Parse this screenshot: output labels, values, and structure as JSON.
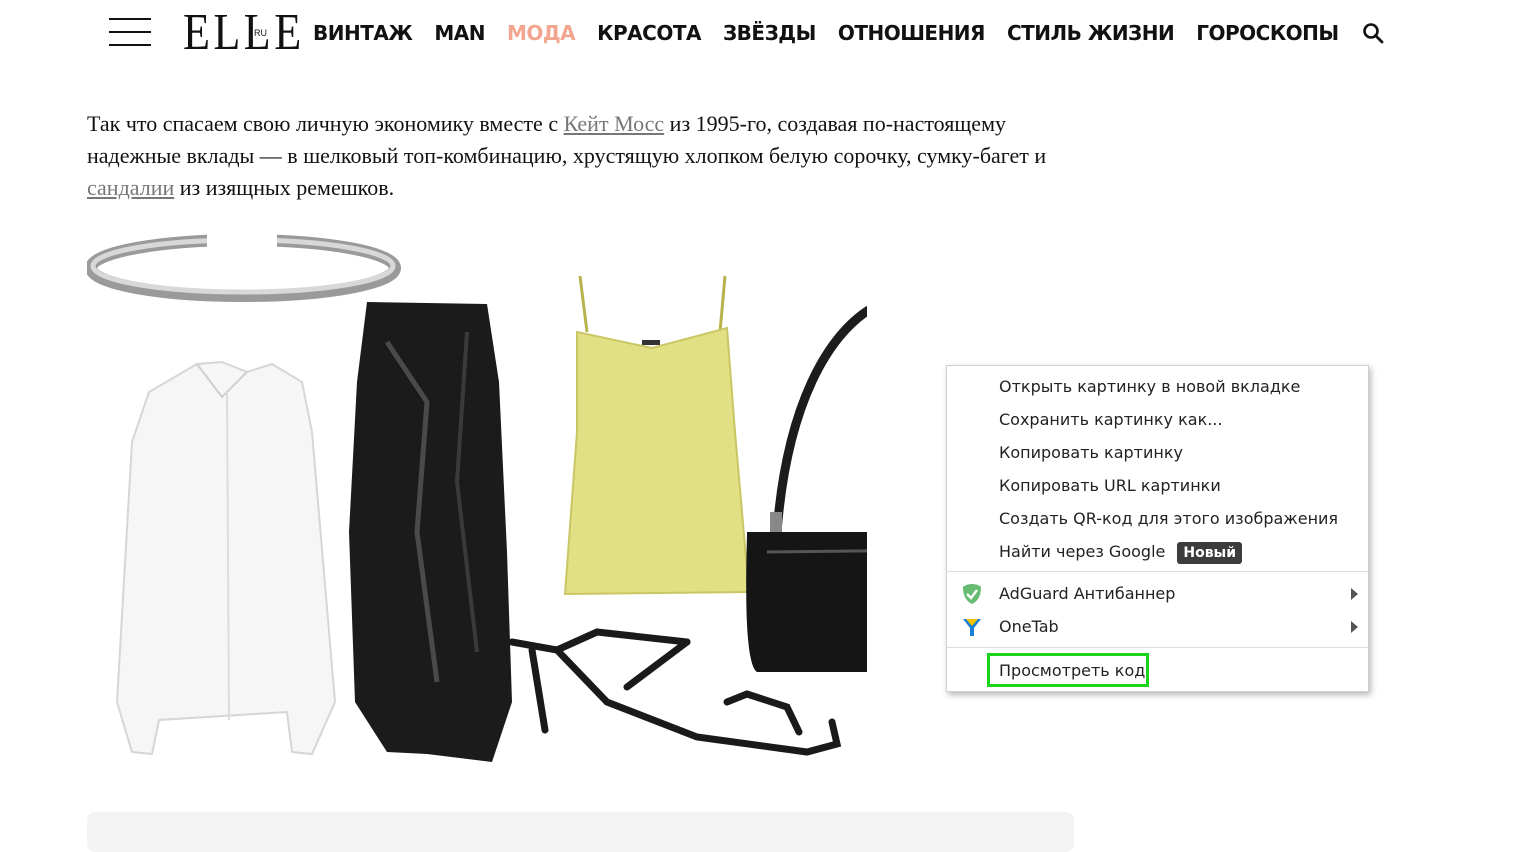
{
  "header": {
    "logo": "ELLE",
    "logo_suffix": "RU",
    "nav": [
      "ВИНТАЖ",
      "MAN",
      "МОДА",
      "КРАСОТА",
      "ЗВЁЗДЫ",
      "ОТНОШЕНИЯ",
      "СТИЛЬ ЖИЗНИ",
      "ГОРОСКОПЫ"
    ],
    "active_nav": "МОДА",
    "active_color": "#f3a68f"
  },
  "article": {
    "text_1": "Так что спасаем свою личную экономику вместе с ",
    "link_1": "Кейт Мосс",
    "text_2": " из 1995-го, создавая по-настоящему надежные вклады — в шелковый топ-комбинацию, хрустящую хлопком белую сорочку, сумку-багет и ",
    "link_2": "сандалии",
    "text_3": " из изящных ремешков."
  },
  "context_menu": {
    "items": [
      "Открыть картинку в новой вкладке",
      "Сохранить картинку как...",
      "Копировать картинку",
      "Копировать URL картинки",
      "Создать QR-код для этого изображения",
      "Найти через Google"
    ],
    "badge": "Новый",
    "extensions": [
      "AdGuard Антибаннер",
      "OneTab"
    ],
    "inspect": "Просмотреть код",
    "highlight_color": "#1bd41b"
  }
}
